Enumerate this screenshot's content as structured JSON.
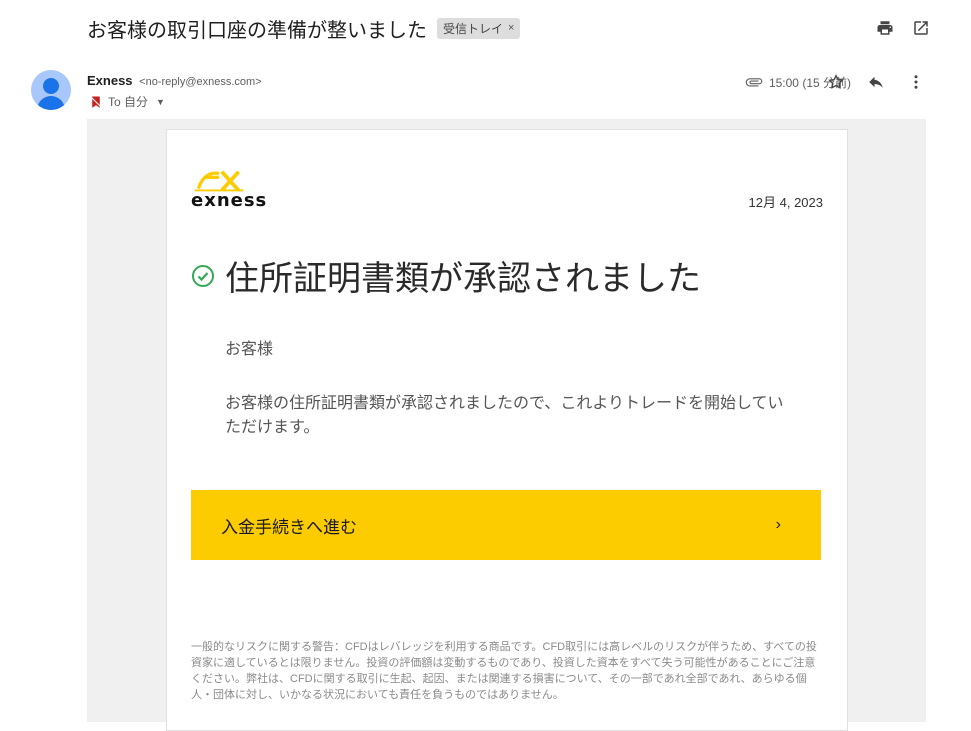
{
  "subject": "お客様の取引口座の準備が整いました",
  "label_chip": {
    "text": "受信トレイ",
    "close": "×"
  },
  "sender": {
    "name": "Exness",
    "email": "<no-reply@exness.com>"
  },
  "recipient": {
    "text": "To 自分"
  },
  "time": "15:00 (15 分前)",
  "icons": {
    "print": "print-icon",
    "open_new": "open-in-new-icon",
    "attachment": "paperclip-icon",
    "star": "star-icon",
    "reply": "reply-icon",
    "more": "more-vert-icon",
    "important": "important-marker-icon"
  },
  "email": {
    "logo_text": "exness",
    "date": "12月 4, 2023",
    "headline": "住所証明書類が承認されました",
    "greeting": "お客様",
    "body": "お客様の住所証明書類が承認されましたので、これよりトレードを開始していただけます。",
    "cta_label": "入金手続きへ進む",
    "cta_arrow": "›",
    "disclaimer": "一般的なリスクに関する警告：CFDはレバレッジを利用する商品です。CFD取引には高レベルのリスクが伴うため、すべての投資家に適しているとは限りません。投資の評価額は変動するものであり、投資した資本をすべて失う可能性があることにご注意ください。弊社は、CFDに関する取引に生起、起因、または関連する損害について、その一部であれ全部であれ、あらゆる個人・団体に対し、いかなる状況においても責任を負うものではありません。"
  },
  "colors": {
    "brand_yellow": "#fccb00",
    "check_green": "#34a853",
    "avatar_bg": "#a8c7fa",
    "avatar_fg": "#1a73e8"
  }
}
